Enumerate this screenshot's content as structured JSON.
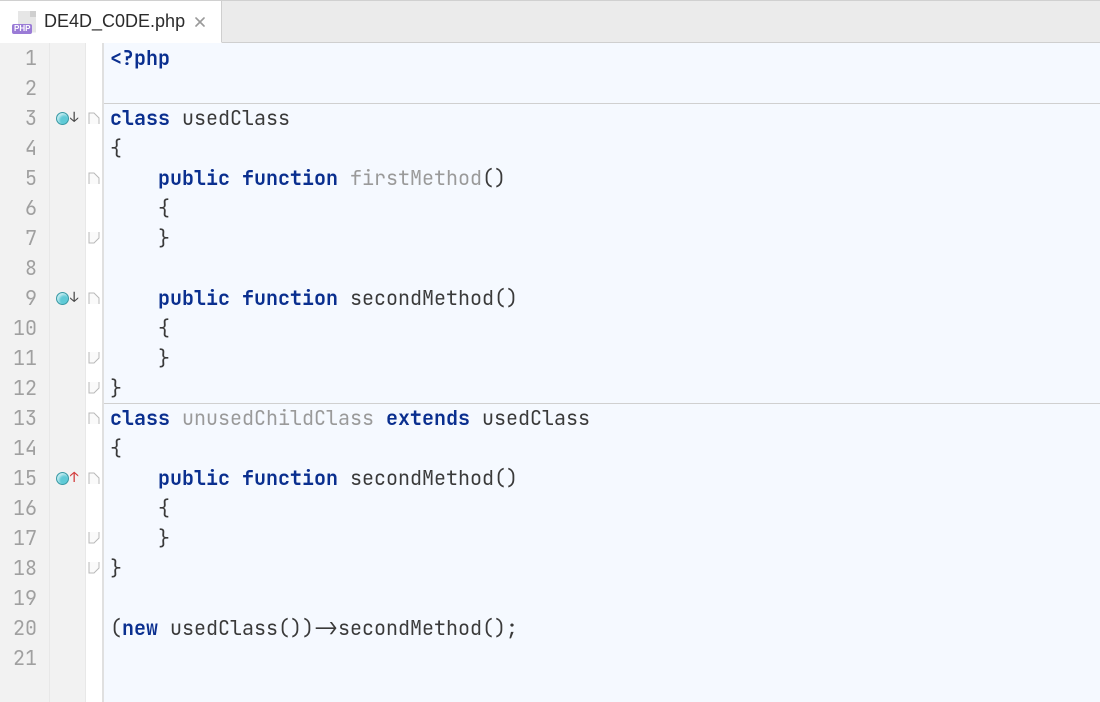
{
  "tab": {
    "filename": "DE4D_C0DE.php",
    "icon_badge": "PHP"
  },
  "gutter_lines": [
    "1",
    "2",
    "3",
    "4",
    "5",
    "6",
    "7",
    "8",
    "9",
    "10",
    "11",
    "12",
    "13",
    "14",
    "15",
    "16",
    "17",
    "18",
    "19",
    "20",
    "21",
    ""
  ],
  "markers": [
    {
      "line": 3,
      "arrow": "down"
    },
    {
      "line": 9,
      "arrow": "down"
    },
    {
      "line": 15,
      "arrow": "up"
    }
  ],
  "folds": [
    {
      "line": 3,
      "kind": "open"
    },
    {
      "line": 5,
      "kind": "open"
    },
    {
      "line": 7,
      "kind": "close"
    },
    {
      "line": 9,
      "kind": "open"
    },
    {
      "line": 11,
      "kind": "close"
    },
    {
      "line": 12,
      "kind": "close"
    },
    {
      "line": 13,
      "kind": "open"
    },
    {
      "line": 15,
      "kind": "open"
    },
    {
      "line": 17,
      "kind": "close"
    },
    {
      "line": 18,
      "kind": "close"
    }
  ],
  "separators": [
    3,
    13
  ],
  "code": [
    [
      {
        "t": "<?php",
        "c": "tagphp"
      }
    ],
    [],
    [
      {
        "t": "class ",
        "c": "kw"
      },
      {
        "t": "usedClass",
        "c": "name"
      }
    ],
    [
      {
        "t": "{",
        "c": "punct"
      }
    ],
    [
      {
        "t": "    ",
        "c": ""
      },
      {
        "t": "public ",
        "c": "kw"
      },
      {
        "t": "function ",
        "c": "kw"
      },
      {
        "t": "firstMethod",
        "c": "unused"
      },
      {
        "t": "()",
        "c": "punct"
      }
    ],
    [
      {
        "t": "    {",
        "c": "punct"
      }
    ],
    [
      {
        "t": "    }",
        "c": "punct"
      }
    ],
    [],
    [
      {
        "t": "    ",
        "c": ""
      },
      {
        "t": "public ",
        "c": "kw"
      },
      {
        "t": "function ",
        "c": "kw"
      },
      {
        "t": "secondMethod",
        "c": "name"
      },
      {
        "t": "()",
        "c": "punct"
      }
    ],
    [
      {
        "t": "    {",
        "c": "punct"
      }
    ],
    [
      {
        "t": "    }",
        "c": "punct"
      }
    ],
    [
      {
        "t": "}",
        "c": "punct"
      }
    ],
    [
      {
        "t": "class ",
        "c": "kw"
      },
      {
        "t": "unusedChildClass ",
        "c": "unused"
      },
      {
        "t": "extends ",
        "c": "kw"
      },
      {
        "t": "usedClass",
        "c": "name"
      }
    ],
    [
      {
        "t": "{",
        "c": "punct"
      }
    ],
    [
      {
        "t": "    ",
        "c": ""
      },
      {
        "t": "public ",
        "c": "kw"
      },
      {
        "t": "function ",
        "c": "kw"
      },
      {
        "t": "secondMethod",
        "c": "name"
      },
      {
        "t": "()",
        "c": "punct"
      }
    ],
    [
      {
        "t": "    {",
        "c": "punct"
      }
    ],
    [
      {
        "t": "    }",
        "c": "punct"
      }
    ],
    [
      {
        "t": "}",
        "c": "punct"
      }
    ],
    [],
    [
      {
        "t": "(",
        "c": "punct"
      },
      {
        "t": "new ",
        "c": "kw"
      },
      {
        "t": "usedClass",
        "c": "name"
      },
      {
        "t": "())->",
        "c": "punct"
      },
      {
        "t": "secondMethod",
        "c": "name"
      },
      {
        "t": "();",
        "c": "punct"
      }
    ],
    [],
    []
  ]
}
